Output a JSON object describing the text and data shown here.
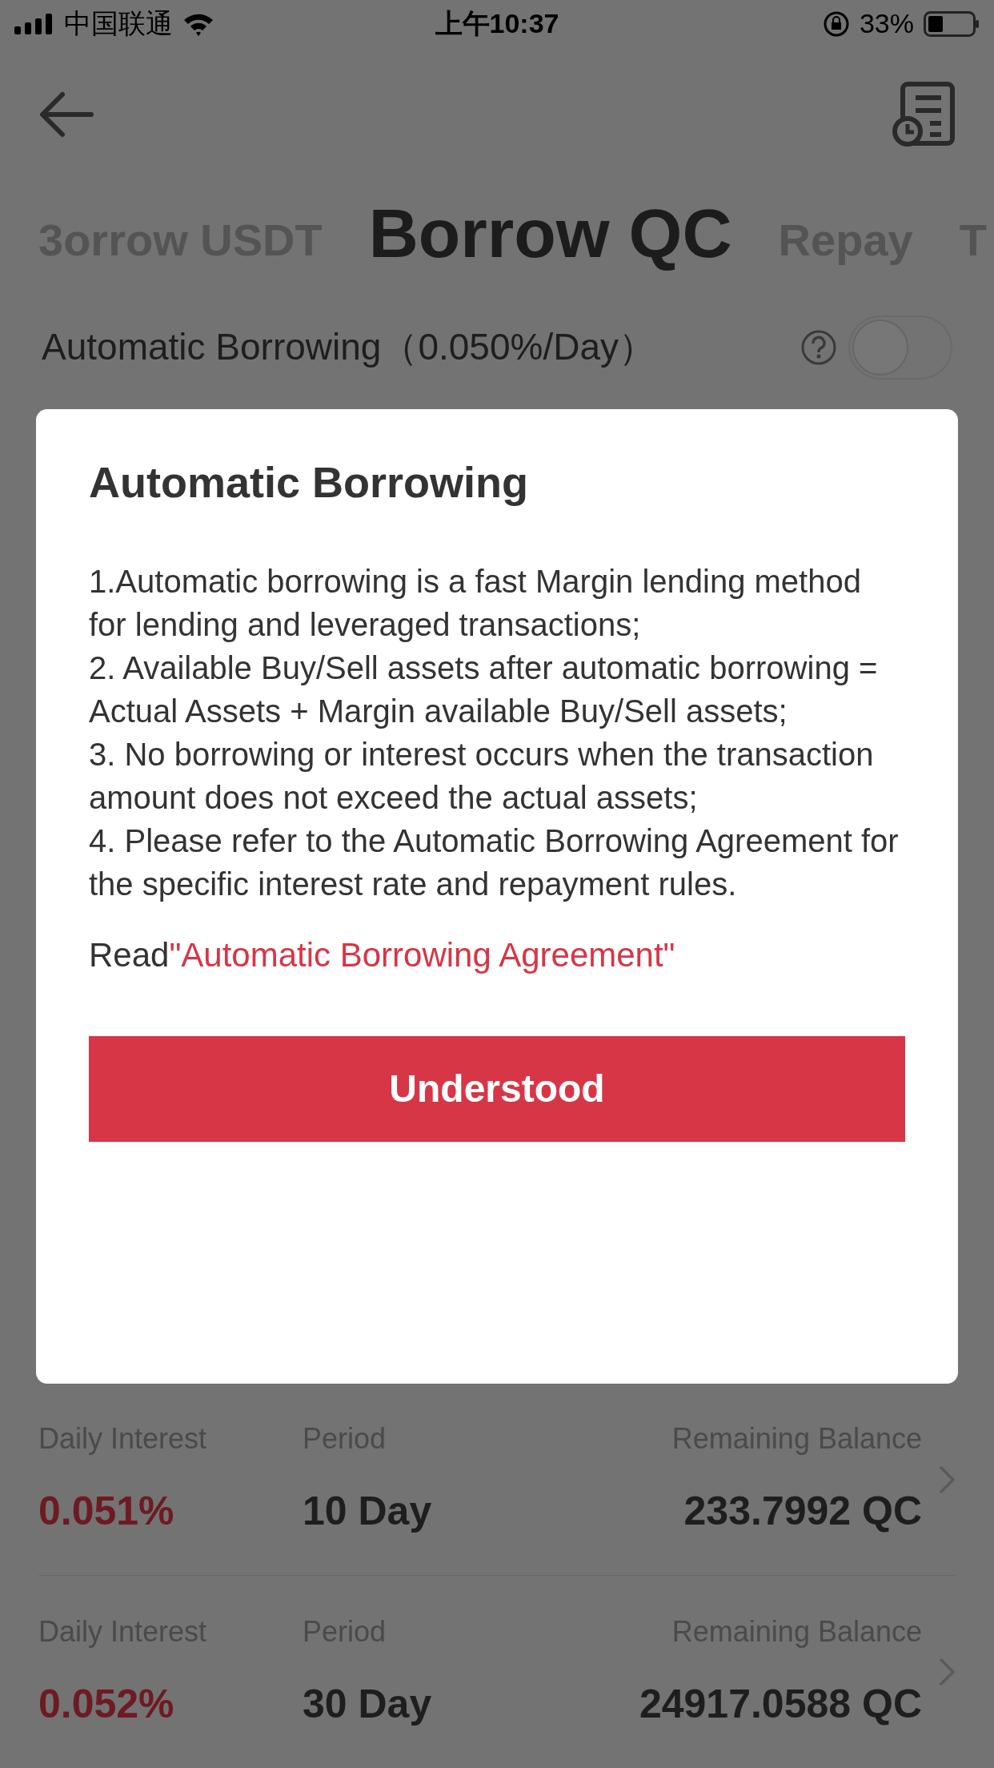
{
  "status_bar": {
    "carrier": "中国联通",
    "time": "上午10:37",
    "battery": "33%"
  },
  "tabs": [
    {
      "label": "3orrow USDT",
      "selected": false
    },
    {
      "label": "Borrow QC",
      "selected": true
    },
    {
      "label": "Repay",
      "selected": false
    },
    {
      "label": "T",
      "selected": false
    }
  ],
  "auto_borrowing": {
    "label": "Automatic Borrowing（0.050%/Day）",
    "on": false
  },
  "dialog": {
    "title": "Automatic Borrowing",
    "items": [
      "1.Automatic borrowing is a fast Margin lending method for lending and leveraged transactions;",
      "2. Available Buy/Sell assets after automatic borrowing = Actual Assets + Margin available Buy/Sell assets;",
      "3. No borrowing or interest occurs when the transaction amount does not exceed the actual assets;",
      "4. Please refer to the Automatic Borrowing Agreement for the specific interest rate and repayment rules."
    ],
    "read_prefix": "Read",
    "link": "\"Automatic Borrowing Agreement\"",
    "button": "Understood"
  },
  "offers": [
    {
      "interest_label": "Daily Interest",
      "interest": "0.051%",
      "period_label": "Period",
      "period": "10 Day",
      "balance_label": "Remaining Balance",
      "balance": "233.7992 QC"
    },
    {
      "interest_label": "Daily Interest",
      "interest": "0.052%",
      "period_label": "Period",
      "period": "30 Day",
      "balance_label": "Remaining Balance",
      "balance": "24917.0588 QC"
    }
  ]
}
